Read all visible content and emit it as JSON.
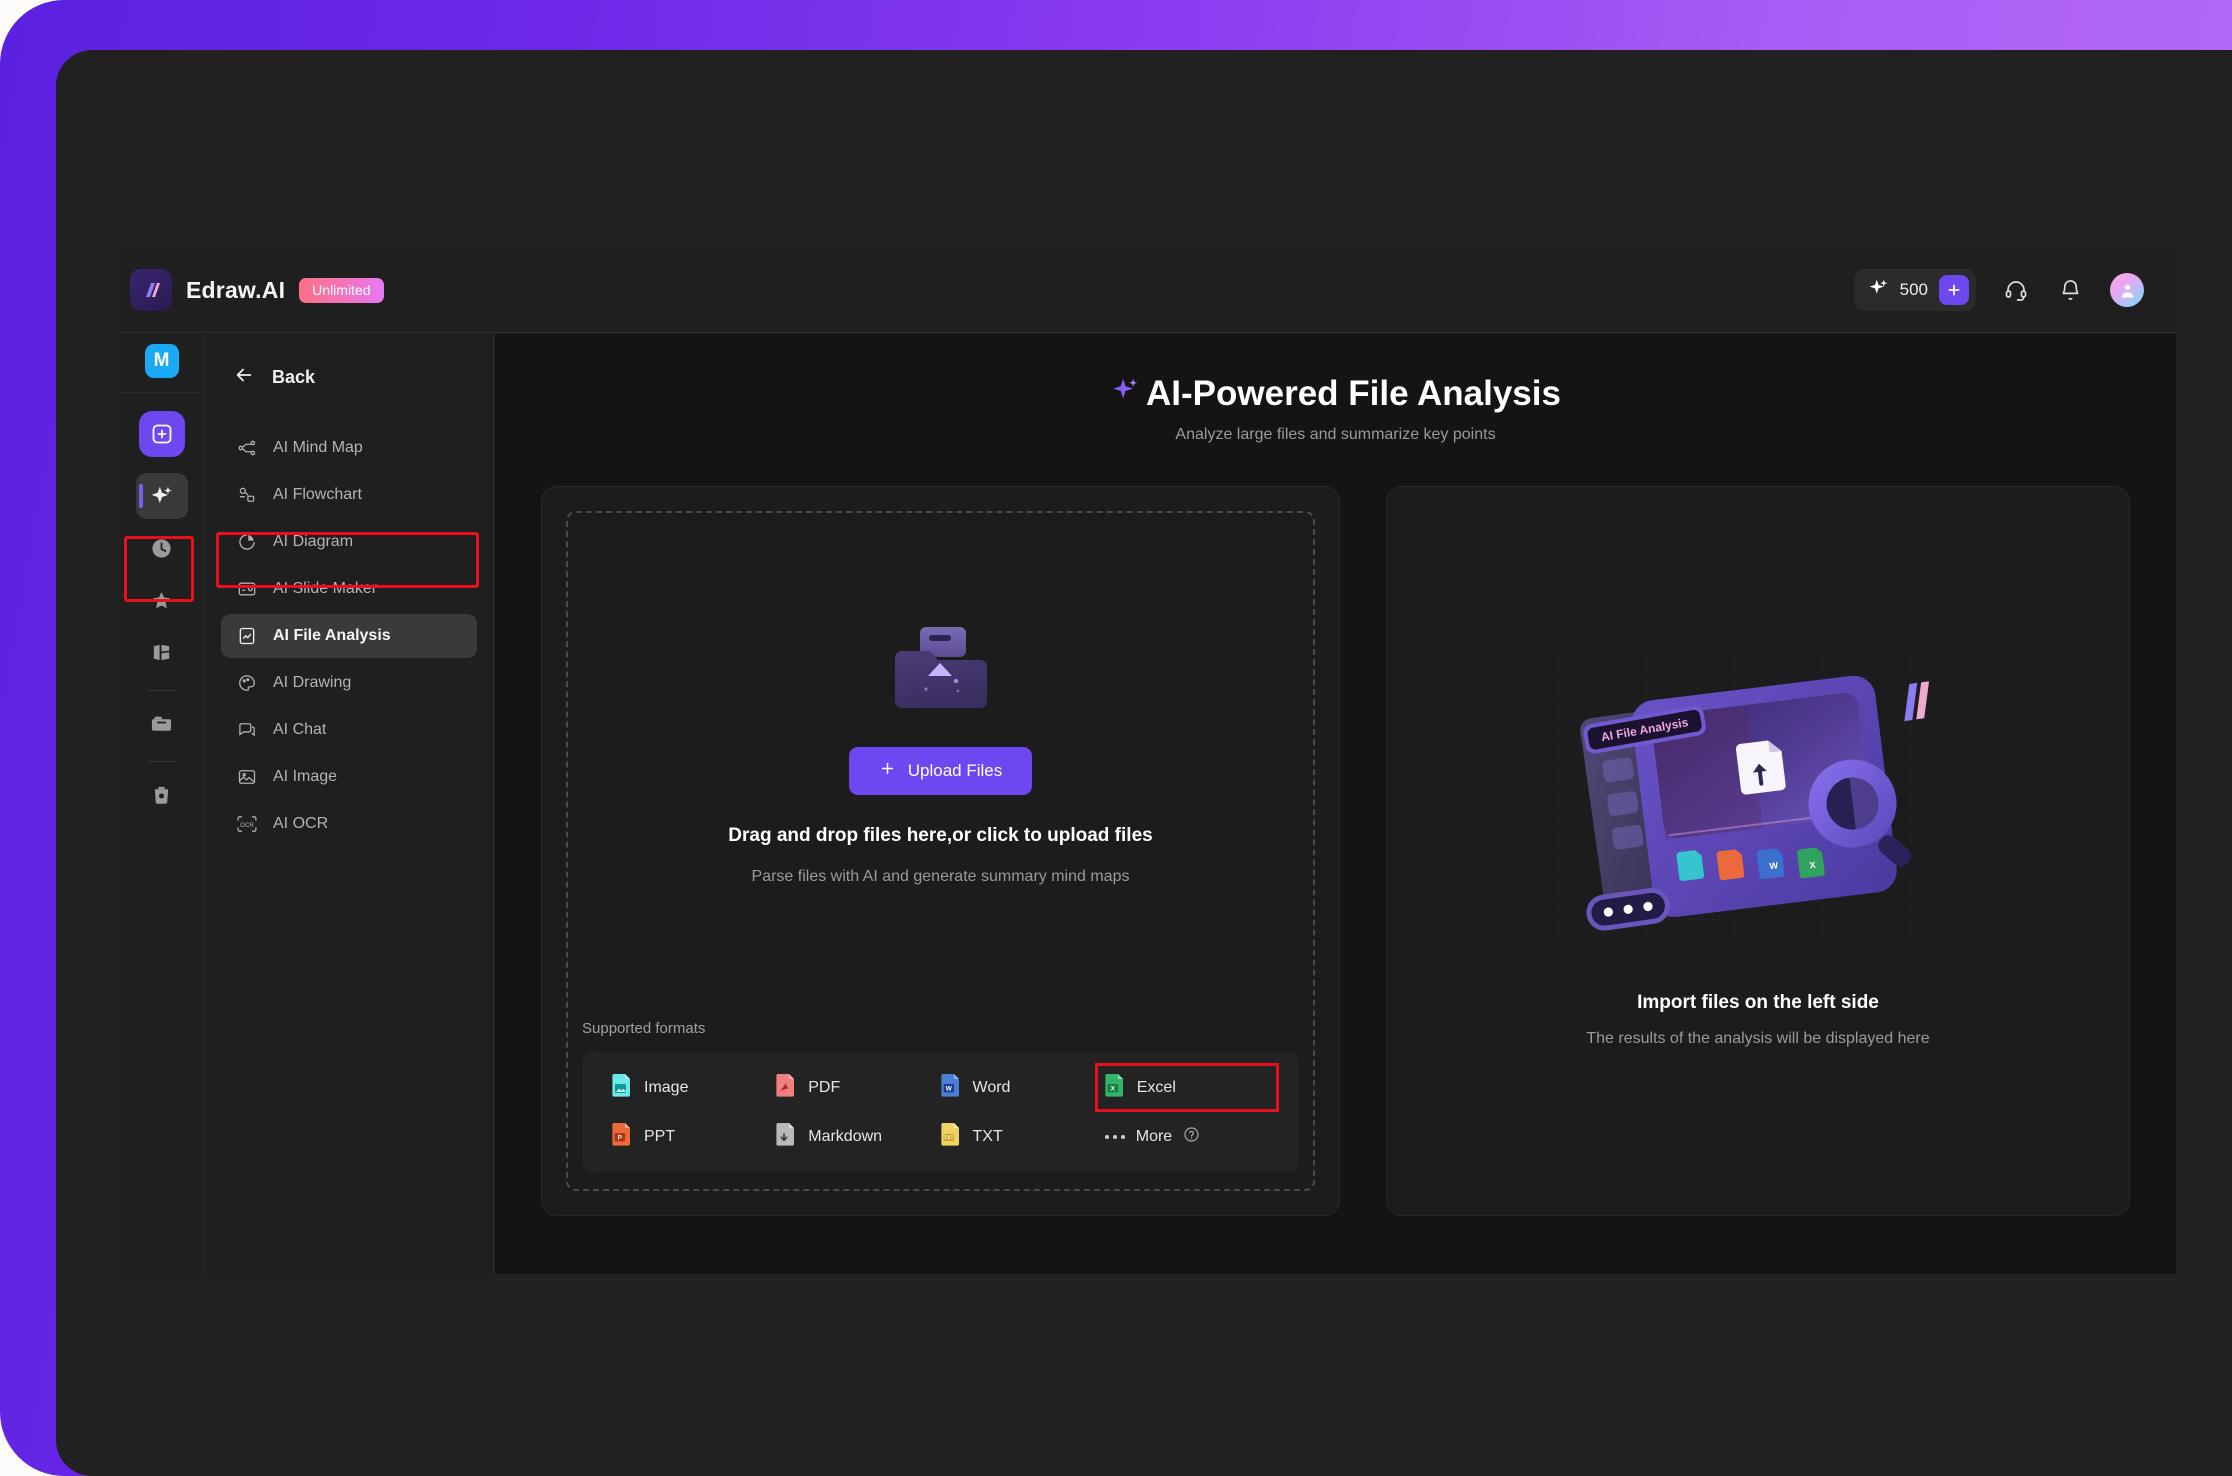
{
  "header": {
    "brand_name": "Edraw.AI",
    "plan_badge": "Unlimited",
    "logo_icon": "edraw-logo-icon",
    "credits": "500",
    "credits_icon": "sparkle-icon",
    "add_credits_icon": "plus-icon",
    "support_icon": "headset-icon",
    "notification_icon": "bell-icon",
    "avatar_icon": "user-avatar-icon"
  },
  "rail": {
    "app_icon_label": "M",
    "items": [
      {
        "name": "new-document",
        "icon": "plus-square-icon"
      },
      {
        "name": "ai-tools",
        "icon": "sparkle-icon",
        "active": true
      },
      {
        "name": "recent",
        "icon": "clock-icon"
      },
      {
        "name": "favorites",
        "icon": "star-icon"
      },
      {
        "name": "templates",
        "icon": "templates-icon"
      },
      {
        "name": "files",
        "icon": "folder-icon"
      },
      {
        "name": "trash",
        "icon": "trash-icon"
      }
    ]
  },
  "nav": {
    "back_label": "Back",
    "back_icon": "arrow-left-icon",
    "items": [
      {
        "label": "AI Mind Map",
        "icon": "mind-map-icon"
      },
      {
        "label": "AI Flowchart",
        "icon": "flowchart-icon"
      },
      {
        "label": "AI Diagram",
        "icon": "pie-chart-icon"
      },
      {
        "label": "AI Slide Maker",
        "icon": "slide-icon"
      },
      {
        "label": "AI File Analysis",
        "icon": "file-analysis-icon",
        "active": true
      },
      {
        "label": "AI Drawing",
        "icon": "palette-icon"
      },
      {
        "label": "AI Chat",
        "icon": "chat-icon"
      },
      {
        "label": "AI Image",
        "icon": "image-icon"
      },
      {
        "label": "AI OCR",
        "icon": "ocr-icon"
      }
    ]
  },
  "main": {
    "title": "AI-Powered File Analysis",
    "title_icon": "sparkle-icon",
    "subtitle": "Analyze large files and summarize key points",
    "upload": {
      "illustration_icon": "folder-upload-illustration",
      "button_label": "Upload Files",
      "button_icon": "plus-icon",
      "drop_text": "Drag and drop files here,or click to upload files",
      "hint_text": "Parse files with AI and generate summary mind maps",
      "formats_title": "Supported formats",
      "formats": [
        {
          "label": "Image",
          "icon": "image-file-icon",
          "color": "#2ec4c4"
        },
        {
          "label": "PDF",
          "icon": "pdf-file-icon",
          "color": "#ef5350"
        },
        {
          "label": "Word",
          "icon": "word-file-icon",
          "color": "#2b6cd4"
        },
        {
          "label": "Excel",
          "icon": "excel-file-icon",
          "color": "#1f9d55",
          "highlighted": true
        },
        {
          "label": "PPT",
          "icon": "ppt-file-icon",
          "color": "#e8521f"
        },
        {
          "label": "Markdown",
          "icon": "markdown-file-icon",
          "color": "#9e9e9e"
        },
        {
          "label": "TXT",
          "icon": "txt-file-icon",
          "color": "#e8c53c"
        }
      ],
      "more_label": "More",
      "more_icon": "ellipsis-icon",
      "more_help_icon": "help-circle-icon"
    },
    "result": {
      "illustration_icon": "file-analysis-illustration",
      "illustration_badge": "AI File Analysis",
      "title": "Import files on the left side",
      "subtitle": "The results of the analysis will be displayed here"
    }
  },
  "annotations": {
    "highlight_color": "#e8111b",
    "boxes": [
      "ai-tools-rail-item",
      "ai-file-analysis-nav-item",
      "excel-format-chip"
    ]
  },
  "theme": {
    "accent": "#6d48f0",
    "frame_gradient_from": "#5b21e0",
    "frame_gradient_to": "#b96ef7",
    "window_bg": "#1f1f1f",
    "content_bg": "#141414"
  }
}
